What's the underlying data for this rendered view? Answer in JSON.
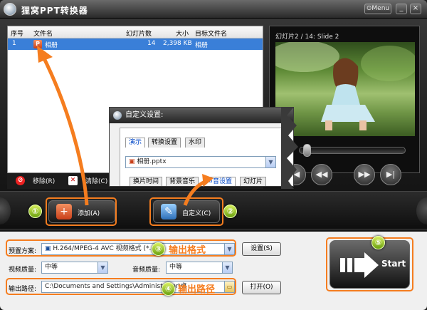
{
  "app": {
    "title": "狸窝PPT转换器",
    "menu_label": "Menu",
    "minimize_label": "_",
    "close_label": "×"
  },
  "file_table": {
    "columns": [
      "序号",
      "文件名",
      "幻灯片数",
      "大小",
      "目标文件名"
    ],
    "rows": [
      {
        "index": "1",
        "name": "相册",
        "slides": "14",
        "size": "2,398 KB",
        "target": "相册"
      }
    ]
  },
  "preview": {
    "title": "幻灯片2 / 14: Slide 2"
  },
  "list_toolbar": {
    "remove_label": "移除(R)",
    "clear_label": "清除(C)"
  },
  "actions": {
    "add_label": "添加(A)",
    "custom_label": "自定义(C)"
  },
  "dialog": {
    "title": "自定义设置:",
    "tabs": [
      "演示",
      "转换设置",
      "水印"
    ],
    "file_combo": "相册.pptx",
    "subtabs": [
      "换片时间",
      "背景音乐",
      "声音设置",
      "幻灯片"
    ]
  },
  "settings": {
    "preset_label": "预置方案:",
    "preset_value": "H.264/MPEG-4 AVC 视频格式 (*.",
    "preset_button": "设置(S)",
    "video_quality_label": "视频质量:",
    "video_quality_value": "中等",
    "audio_quality_label": "音频质量:",
    "audio_quality_value": "中等",
    "output_label": "输出路径:",
    "output_value": "C:\\Documents and Settings\\Administrator\\桌",
    "open_button": "打开(O)"
  },
  "annotations": {
    "step1": "①",
    "step2": "②",
    "step3": "③",
    "step4": "④",
    "step5": "⑤",
    "output_format_note": "输出格式",
    "output_path_note": "输出路径"
  },
  "start": {
    "label": "Start"
  },
  "colors": {
    "accent": "#f57d1f",
    "selected_row": "#3a7fd8",
    "step_badge": "#8cc63f"
  }
}
